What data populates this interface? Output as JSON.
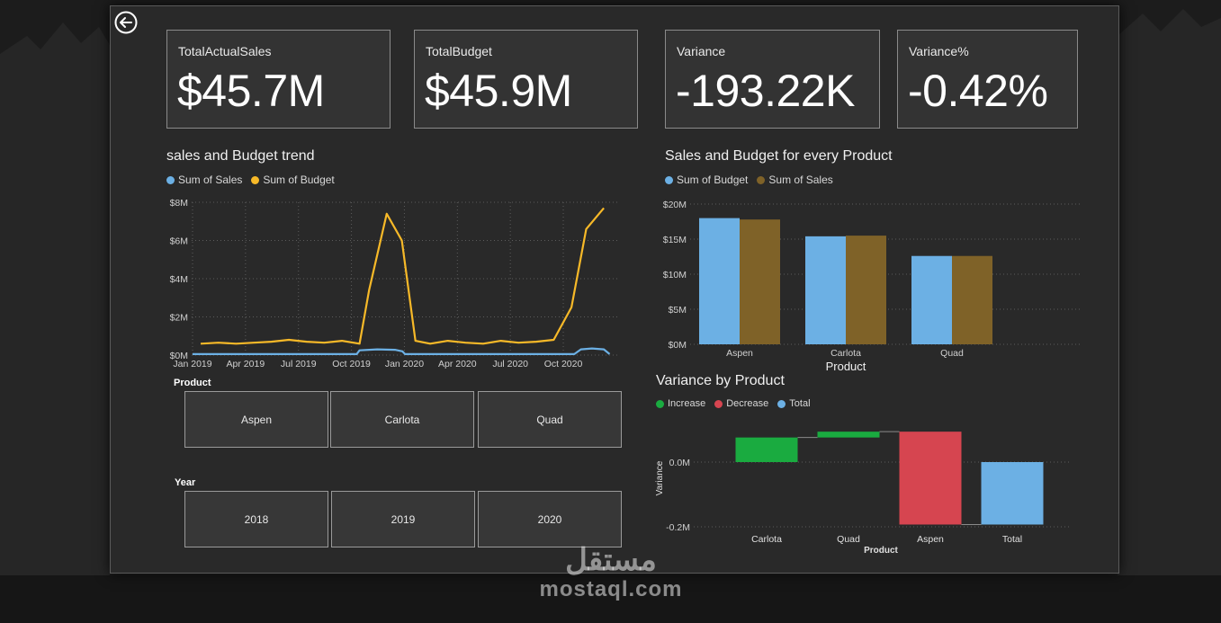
{
  "kpis": [
    {
      "label": "TotalActualSales",
      "value": "$45.7M"
    },
    {
      "label": "TotalBudget",
      "value": "$45.9M"
    },
    {
      "label": "Variance",
      "value": "-193.22K"
    },
    {
      "label": "Variance%",
      "value": "-0.42%"
    }
  ],
  "trend": {
    "title": "sales and Budget trend",
    "legend": [
      {
        "label": "Sum of Sales",
        "color": "#6cb0e4"
      },
      {
        "label": "Sum of Budget",
        "color": "#f7b928"
      }
    ]
  },
  "product_chart": {
    "title": "Sales and Budget for every Product",
    "legend": [
      {
        "label": "Sum of Budget",
        "color": "#6cb0e4"
      },
      {
        "label": "Sum of Sales",
        "color": "#7f6228"
      }
    ]
  },
  "variance_chart": {
    "title": "Variance by Product",
    "legend": [
      {
        "label": "Increase",
        "color": "#1aab40"
      },
      {
        "label": "Decrease",
        "color": "#d64550"
      },
      {
        "label": "Total",
        "color": "#6cb0e4"
      }
    ]
  },
  "slicers": {
    "product": {
      "title": "Product",
      "options": [
        "Aspen",
        "Carlota",
        "Quad"
      ]
    },
    "year": {
      "title": "Year",
      "options": [
        "2018",
        "2019",
        "2020"
      ]
    }
  },
  "watermark": {
    "logo": "مستقل",
    "url": "mostaql.com"
  },
  "chart_data": [
    {
      "type": "line",
      "title": "sales and Budget trend",
      "x_ticks": [
        "Jan 2019",
        "Apr 2019",
        "Jul 2019",
        "Oct 2019",
        "Jan 2020",
        "Apr 2020",
        "Jul 2020",
        "Oct 2020"
      ],
      "y_ticks": [
        "$0M",
        "$2M",
        "$4M",
        "$6M",
        "$8M"
      ],
      "ylim": [
        0,
        8
      ],
      "y_unit": "$M",
      "x_start": "2019-01",
      "series": [
        {
          "name": "Sum of Budget",
          "color": "#f7b928",
          "points": [
            [
              "2019-01-15",
              0.6
            ],
            [
              "2019-02-15",
              0.65
            ],
            [
              "2019-03-15",
              0.6
            ],
            [
              "2019-04-15",
              0.65
            ],
            [
              "2019-05-15",
              0.7
            ],
            [
              "2019-06-15",
              0.8
            ],
            [
              "2019-07-15",
              0.7
            ],
            [
              "2019-08-15",
              0.65
            ],
            [
              "2019-09-15",
              0.75
            ],
            [
              "2019-10-15",
              0.6
            ],
            [
              "2019-11-01",
              3.4
            ],
            [
              "2019-12-01",
              7.4
            ],
            [
              "2019-12-27",
              6.0
            ],
            [
              "2020-01-20",
              0.75
            ],
            [
              "2020-02-15",
              0.6
            ],
            [
              "2020-03-15",
              0.75
            ],
            [
              "2020-04-15",
              0.65
            ],
            [
              "2020-05-15",
              0.6
            ],
            [
              "2020-06-15",
              0.75
            ],
            [
              "2020-07-15",
              0.65
            ],
            [
              "2020-08-15",
              0.7
            ],
            [
              "2020-09-15",
              0.8
            ],
            [
              "2020-10-15",
              2.5
            ],
            [
              "2020-11-10",
              6.6
            ],
            [
              "2020-12-10",
              7.7
            ]
          ]
        },
        {
          "name": "Sum of Sales",
          "color": "#6cb0e4",
          "points": [
            [
              "2019-01-01",
              0.05
            ],
            [
              "2019-10-10",
              0.05
            ],
            [
              "2019-10-15",
              0.25
            ],
            [
              "2019-11-15",
              0.3
            ],
            [
              "2019-12-15",
              0.28
            ],
            [
              "2019-12-28",
              0.2
            ],
            [
              "2020-01-02",
              0.05
            ],
            [
              "2020-10-20",
              0.05
            ],
            [
              "2020-11-01",
              0.3
            ],
            [
              "2020-11-20",
              0.35
            ],
            [
              "2020-12-10",
              0.3
            ],
            [
              "2020-12-20",
              0.05
            ]
          ]
        }
      ]
    },
    {
      "type": "bar",
      "title": "Sales and Budget for every Product",
      "categories": [
        "Aspen",
        "Carlota",
        "Quad"
      ],
      "xlabel": "Product",
      "y_ticks": [
        "$0M",
        "$5M",
        "$10M",
        "$15M",
        "$20M"
      ],
      "ylim": [
        0,
        20
      ],
      "y_unit": "$M",
      "series": [
        {
          "name": "Sum of Budget",
          "color": "#6cb0e4",
          "values": [
            18.0,
            15.4,
            12.6
          ]
        },
        {
          "name": "Sum of Sales",
          "color": "#7f6228",
          "values": [
            17.8,
            15.5,
            12.6
          ]
        }
      ]
    },
    {
      "type": "bar",
      "subtype": "waterfall",
      "title": "Variance by Product",
      "categories": [
        "Carlota",
        "Quad",
        "Aspen",
        "Total"
      ],
      "xlabel": "Product",
      "ylabel": "Variance",
      "y_ticks": [
        "0.0M",
        "-0.2M"
      ],
      "y_unit": "$M",
      "ylim": [
        -0.2,
        0.08
      ],
      "values": [
        0.076,
        0.018,
        -0.287,
        -0.193
      ],
      "kinds": [
        "Increase",
        "Increase",
        "Decrease",
        "Total"
      ]
    }
  ]
}
